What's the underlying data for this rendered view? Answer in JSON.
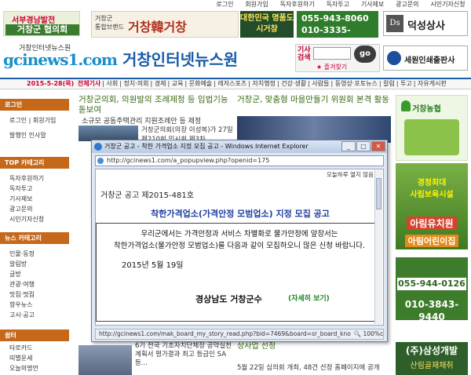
{
  "toplinks": [
    "로그인",
    "회원가입",
    "독자후원하기",
    "독자투고",
    "기사제보",
    "광고문의",
    "시민기자신청"
  ],
  "banners": {
    "b1_line1": "서부경남발전",
    "b1_line2": "거창군 협의회",
    "b2_small1": "거창군",
    "b2_small2": "통합브랜드",
    "b2_brand": "거창韓거창",
    "b3": "대한민국 명품도시거창",
    "b4_line1": "055-943-8060",
    "b4_line2": "010-3335-8060",
    "b5_logo": "Ds",
    "b5_name": "덕성상사",
    "b6_name": "세원인쇄출판사"
  },
  "site": {
    "logo_small": "거창인터넷뉴스원",
    "logo_main_a": "gcinews",
    "logo_main_b": "1.com",
    "name": "거창인터넷뉴스원"
  },
  "search": {
    "label": "기사검색",
    "button": "go",
    "favorite": "즐겨찾기"
  },
  "nav": {
    "date": "2015-5-28(목)",
    "items": [
      "전체기사",
      "사회",
      "정치·의회",
      "경제",
      "교육",
      "문화예술",
      "레저스포츠",
      "자치행정",
      "건강·생활",
      "사람들",
      "동영상·포토뉴스",
      "칼럼",
      "투고",
      "자유게시판"
    ]
  },
  "sidebar": {
    "s1_header": "로그인",
    "s1_items": [
      "로그인 | 회원가입",
      "발행인 인사말"
    ],
    "s2_header": "TOP 카테고리",
    "s2_items": [
      "독자후원하기",
      "독자투고",
      "기사제보",
      "광고문의",
      "시민기자신청"
    ],
    "s3_header": "뉴스 카테고리",
    "s3_items": [
      "인물·동정",
      "알림방",
      "글방",
      "관광·여행",
      "맛집·멋집",
      "향우뉴스",
      "고시·공고"
    ],
    "s4_header": "쉼터",
    "s4_items": [
      "타로카드",
      "띠별운세",
      "오늘의명언"
    ]
  },
  "news": {
    "h1": "거창군의회, 의원발의 조례제정 등 입법기능 돋보여",
    "sub1": "소규모 공동주택관리 지원조례안 등 제정",
    "txt1": "거창군의회(의장 이성복)가 27일 제210회 임시회 제3차",
    "h2": "거창군, 맞춤형 마을만들기 위원회 본격 활동",
    "bn1": "6기 전국 기초자치단체장 공약실천계획서 평가결과 최고 등급인 SA등...",
    "bn2": "상사업 선정",
    "bn3": "5월 22일 심의회 개최, 48건 선정 홈페이지에 공개"
  },
  "right_ads": {
    "a1": "거창농협",
    "a2_l1": "경청최대",
    "a2_l2": "사립보육시설",
    "a2_l3": "아림유치원",
    "a2_l4": "아림어린이집",
    "a3_l1": "055-944-0126",
    "a3_l2": "010-3843-9440",
    "a4_l1": "(주)삼성개발",
    "a4_l2": "산림골재채취"
  },
  "popup": {
    "title": "거창군 공고 - 착한 가격업소 지정 모집 공고 - Windows Internet Explorer",
    "url": "http://gcinews1.com/a_popupview.php?openid=175",
    "today_close": "오늘하루 열지 않음",
    "notice_no": "거창군 공고 제2015-481호",
    "heading": "착한가격업소(가격안정 모범업소) 지정 모집 공고",
    "body_line1": "우리군에서는 가격안정과 서비스 차별화로 물가안정에 앞장서는",
    "body_line2": "착한가격업소(물가안정 모범업소)를 다음과 같이 모집하오니 많은 신청 바랍니다.",
    "date": "2015년  5월  19일",
    "org": "경상남도 거창군수",
    "more": "(자세히 보기)",
    "status_url": "http://gcinews1.com/mak_board_my_story_read.php?bid=7469&board=sr_board_know&board_cmt=sr_boa",
    "zoom": "100%"
  }
}
